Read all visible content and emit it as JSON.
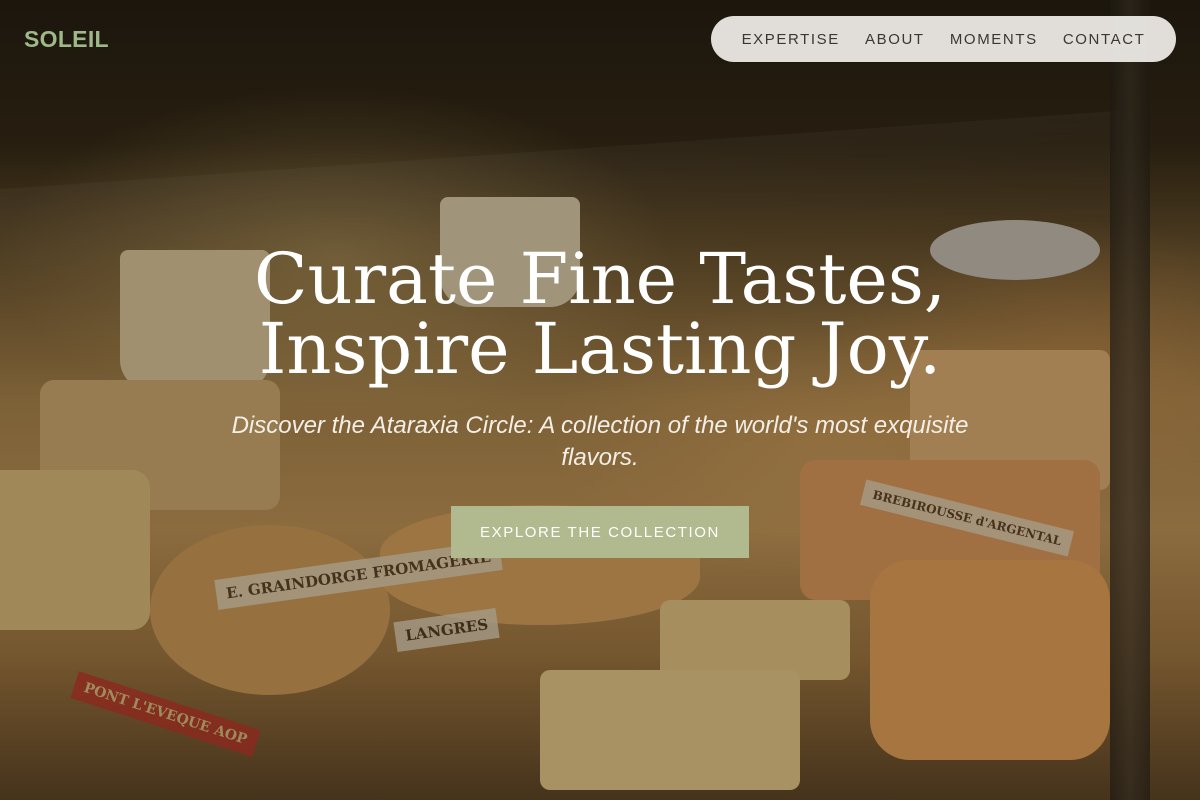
{
  "brand": {
    "logo_text": "SOLEIL",
    "logo_color": "#9eb889"
  },
  "nav": {
    "items": [
      {
        "label": "EXPERTISE"
      },
      {
        "label": "ABOUT"
      },
      {
        "label": "MOMENTS"
      },
      {
        "label": "CONTACT"
      }
    ]
  },
  "hero": {
    "title_line1": "Curate Fine Tastes,",
    "title_line2": "Inspire Lasting Joy.",
    "subtitle": "Discover the Ataraxia Circle: A collection of the world's most exquisite flavors.",
    "cta_label": "EXPLORE THE COLLECTION",
    "cta_color": "#b1b98e",
    "background_labels": [
      "E. GRAINDORGE FROMAGERIE",
      "LANGRES",
      "PONT L'EVEQUE AOP",
      "BREBIROUSSE d'ARGENTAL"
    ]
  }
}
